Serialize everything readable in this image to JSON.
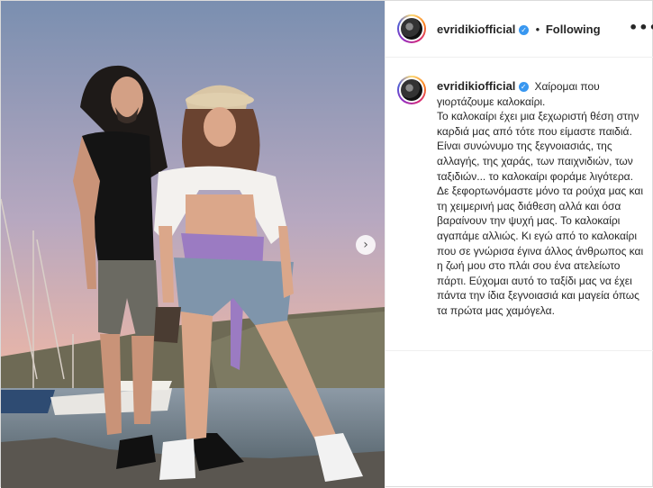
{
  "post": {
    "image_alt": "",
    "next_icon": "chevron-right-icon",
    "next_glyph": "›"
  },
  "header": {
    "username": "evridikiofficial",
    "verified_glyph": "✓",
    "separator": "•",
    "follow_status": "Following",
    "more_glyph": "•••"
  },
  "caption": {
    "username": "evridikiofficial",
    "text": " Χαίρομαι που γιορτάζουμε καλοκαίρι.\nΤο καλοκαίρι έχει μια ξεχωριστή θέση στην καρδιά μας από τότε που είμαστε παιδιά. Είναι συνώνυμο της ξεγνοιασιάς, της αλλαγής, της χαράς, των παιχνιδιών, των ταξιδιών... το καλοκαίρι φοράμε λιγότερα. Δε ξεφορτωνόμαστε μόνο τα ρούχα μας και τη χειμερινή μας διάθεση αλλά και όσα βαραίνουν την ψυχή μας. Το καλοκαίρι αγαπάμε αλλιώς. Κι εγώ από το καλοκαίρι που σε γνώρισα έγινα άλλος άνθρωπος και η ζωή μου στο πλάι σου ένα ατελείωτο πάρτι. Εύχομαι αυτό το ταξίδι μας να έχει πάντα την ίδια ξεγνοιασιά και μαγεία όπως τα πρώτα μας χαμόγελα."
  },
  "colors": {
    "verified": "#3897f0",
    "text": "#262626",
    "border": "#dbdbdb"
  }
}
